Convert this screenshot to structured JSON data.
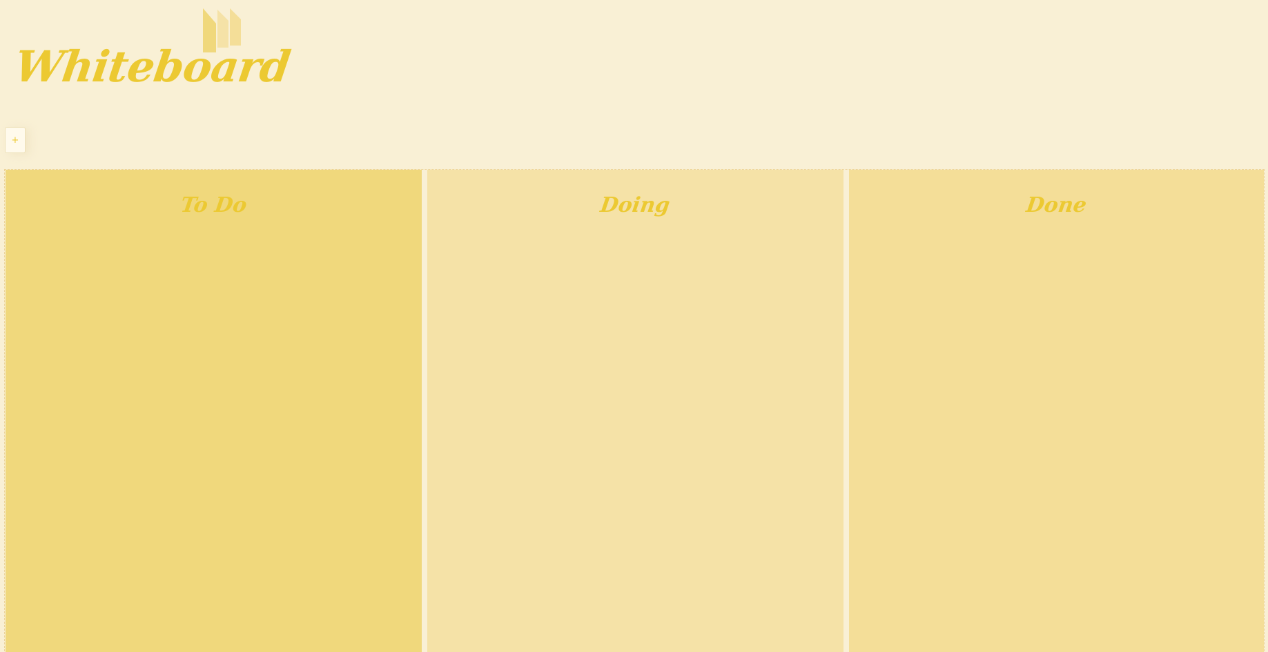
{
  "app": {
    "title": "Whiteboard",
    "logo_icon": "bar-steps-icon"
  },
  "toolbar": {
    "add_label": "+"
  },
  "board": {
    "columns": [
      {
        "title": "To Do",
        "color": "#f0d87c"
      },
      {
        "title": "Doing",
        "color": "#f5e2a7"
      },
      {
        "title": "Done",
        "color": "#f4de98"
      }
    ]
  },
  "colors": {
    "background": "#f9f0d5",
    "accent": "#ecc932"
  }
}
